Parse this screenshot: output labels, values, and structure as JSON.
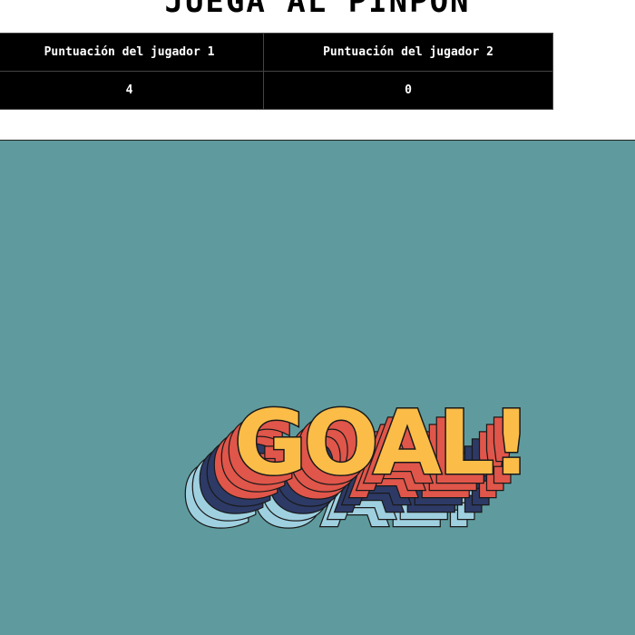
{
  "game": {
    "title": "JUEGA AL PINPON",
    "scoreboard": {
      "headers": [
        "Puntuación del jugador 1",
        "Puntuación del jugador 2"
      ],
      "scores": [
        "4",
        "0"
      ]
    },
    "field": {
      "goal_text": "GOAL!",
      "colors": {
        "background": "#5f9b9e",
        "goal_fill": "#fbbd48",
        "layer_red": "#e0564a",
        "layer_navy": "#2d3a66",
        "layer_light_blue": "#9fd0e0",
        "outline": "#1a1a1a"
      }
    }
  }
}
